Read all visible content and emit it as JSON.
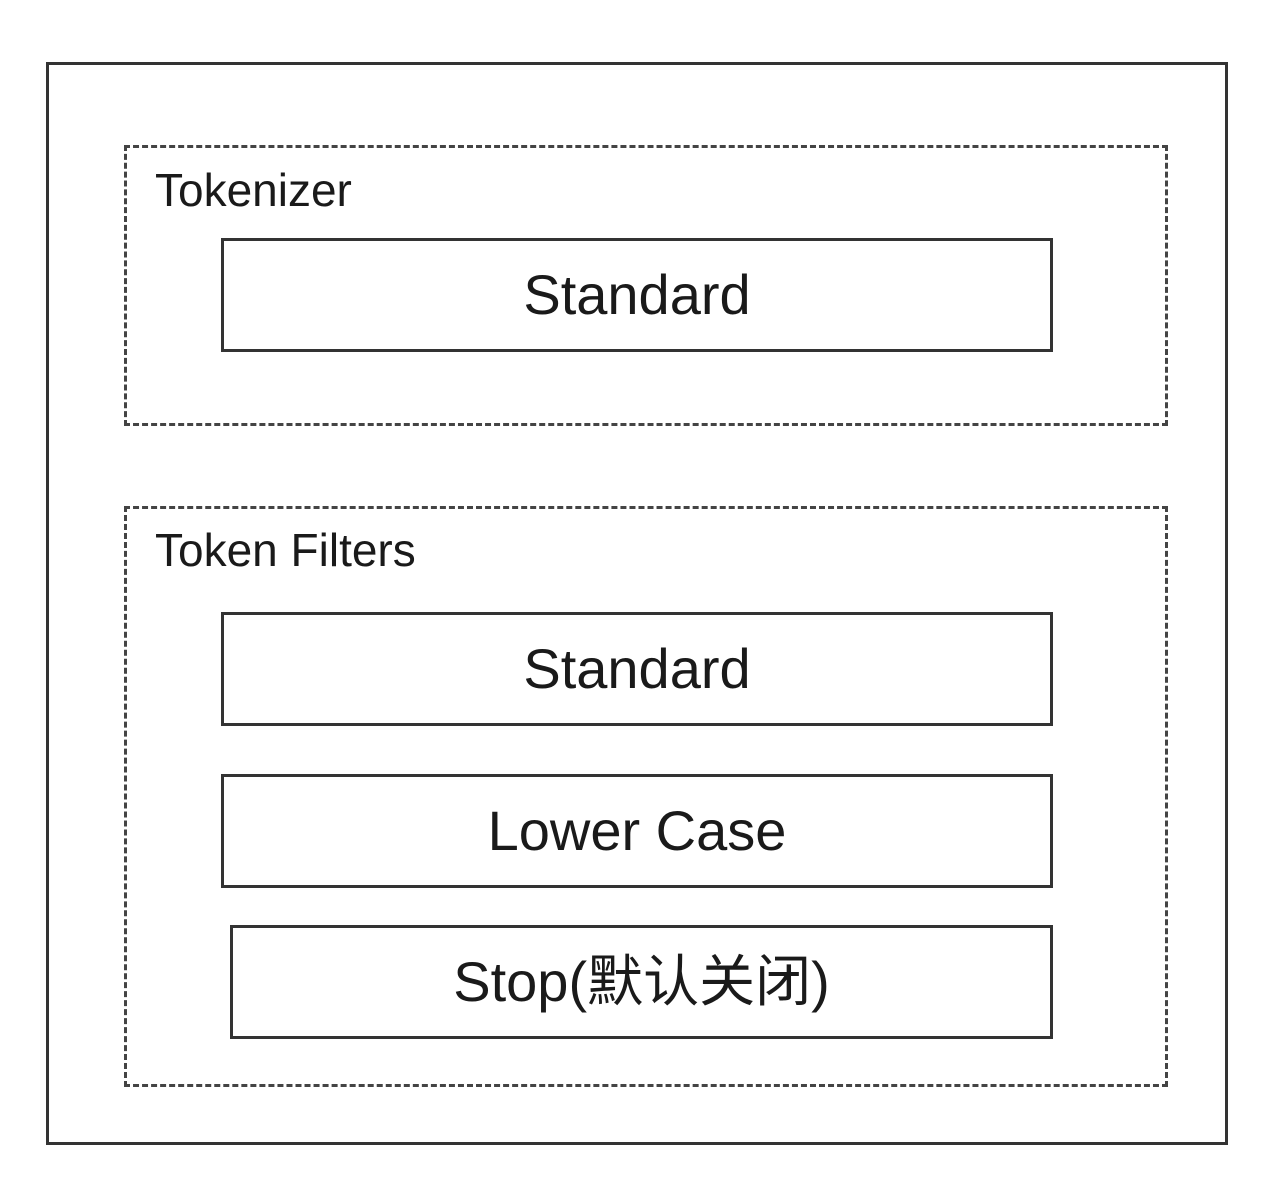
{
  "tokenizer": {
    "title": "Tokenizer",
    "items": [
      {
        "label": "Standard"
      }
    ]
  },
  "token_filters": {
    "title": "Token Filters",
    "items": [
      {
        "label": "Standard"
      },
      {
        "label": "Lower Case"
      },
      {
        "label": "Stop(默认关闭)"
      }
    ]
  }
}
